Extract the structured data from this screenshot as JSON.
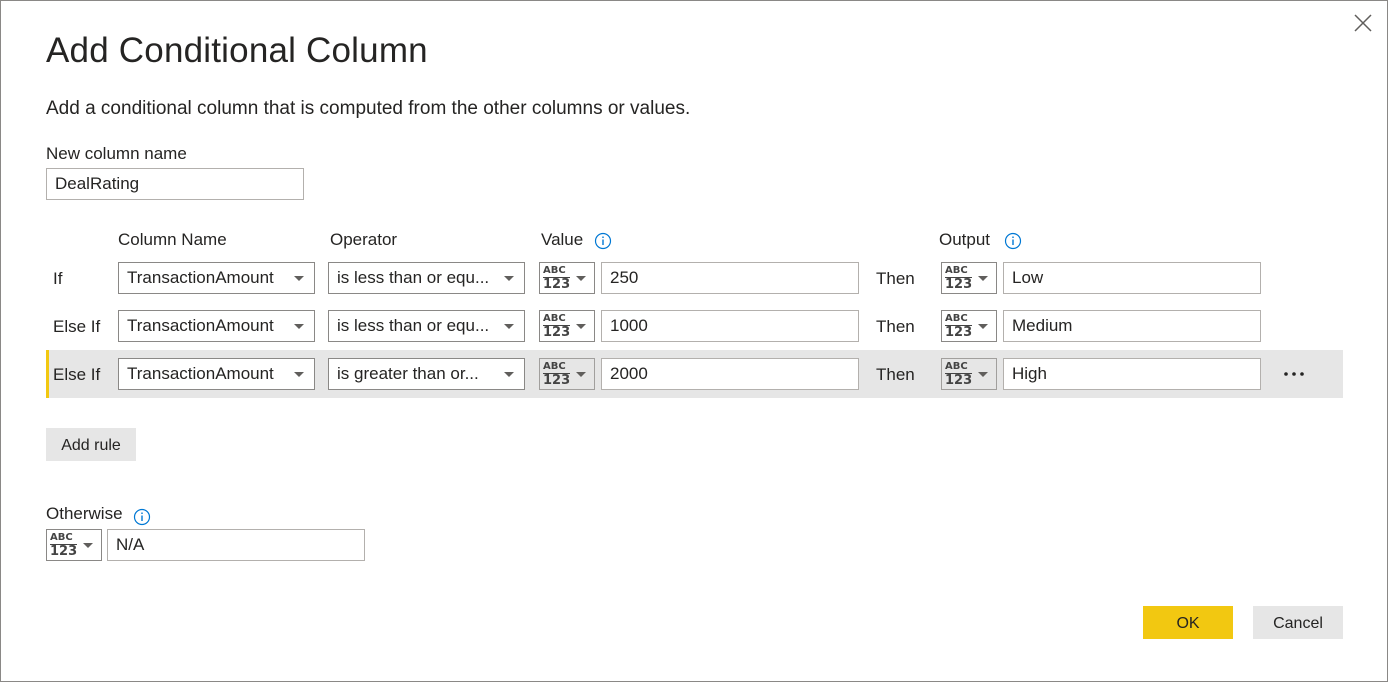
{
  "dialog": {
    "title": "Add Conditional Column",
    "subtitle": "Add a conditional column that is computed from the other columns or values.",
    "new_column_label": "New column name",
    "new_column_value": "DealRating"
  },
  "headers": {
    "column_name": "Column Name",
    "operator": "Operator",
    "value": "Value",
    "output": "Output"
  },
  "rules": [
    {
      "clause": "If",
      "column": "TransactionAmount",
      "operator": "is less than or equ...",
      "value_type": [
        "ABC",
        "123"
      ],
      "value": "250",
      "then": "Then",
      "output_type": [
        "ABC",
        "123"
      ],
      "output": "Low"
    },
    {
      "clause": "Else If",
      "column": "TransactionAmount",
      "operator": "is less than or equ...",
      "value_type": [
        "ABC",
        "123"
      ],
      "value": "1000",
      "then": "Then",
      "output_type": [
        "ABC",
        "123"
      ],
      "output": "Medium"
    },
    {
      "clause": "Else If",
      "column": "TransactionAmount",
      "operator": "is greater than or...",
      "value_type": [
        "ABC",
        "123"
      ],
      "value": "2000",
      "then": "Then",
      "output_type": [
        "ABC",
        "123"
      ],
      "output": "High"
    }
  ],
  "add_rule_label": "Add rule",
  "otherwise": {
    "label": "Otherwise",
    "type": [
      "ABC",
      "123"
    ],
    "value": "N/A"
  },
  "buttons": {
    "ok": "OK",
    "cancel": "Cancel"
  },
  "icons": {
    "close": "close-icon",
    "info": "info-icon",
    "more": "more-options-icon",
    "dropdown": "chevron-down-icon",
    "type": "any-type-icon"
  },
  "colors": {
    "accent": "#f2c811",
    "highlight_row": "#e6e6e6",
    "button_gray": "#e6e6e6"
  }
}
